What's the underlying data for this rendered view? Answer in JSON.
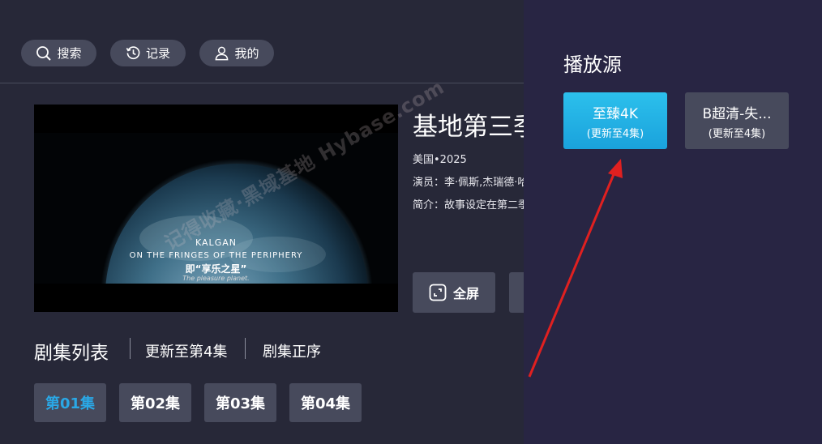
{
  "top_nav": {
    "search_label": "搜索",
    "history_label": "记录",
    "profile_label": "我的"
  },
  "player": {
    "sub_line1": "KALGAN",
    "sub_line2": "ON THE FRINGES OF THE PERIPHERY",
    "sub_line3": "即“享乐之星”",
    "sub_line4": "The pleasure planet.",
    "watermark": "记得收藏·黑域基地 Hybase.com"
  },
  "detail": {
    "title": "基地第三季",
    "meta": "美国•2025",
    "cast": "演员：李·佩斯,杰瑞德·哈里斯",
    "intro": "简介：故事设定在第二季"
  },
  "actions": {
    "fullscreen_label": "全屏"
  },
  "episodes": {
    "header": "剧集列表",
    "update_status": "更新至第4集",
    "order_label": "剧集正序",
    "items": [
      "第01集",
      "第02集",
      "第03集",
      "第04集"
    ],
    "active_index": 0,
    "active_color": "#2aa8e6"
  },
  "source_panel": {
    "title": "播放源",
    "sources": [
      {
        "name": "至臻4K",
        "status": "(更新至4集)"
      },
      {
        "name": "B超清-失...",
        "status": "(更新至4集)"
      }
    ],
    "active_color": "#1fb0e6"
  },
  "annotation_color": "#e02020"
}
